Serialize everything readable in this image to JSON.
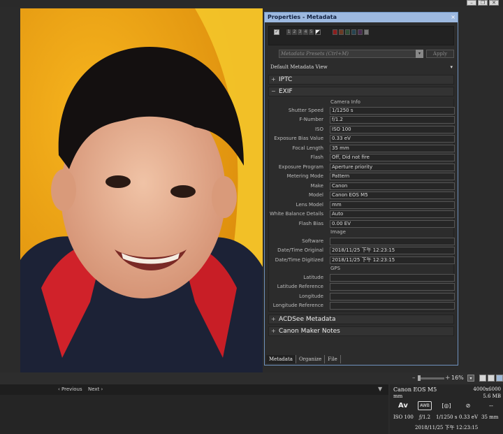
{
  "window": {
    "minimize": "–",
    "restore": "❐",
    "close": "✕"
  },
  "panel": {
    "title": "Properties - Metadata",
    "close_glyph": "×",
    "rating_numbers": [
      "1",
      "2",
      "3",
      "4",
      "5"
    ],
    "color_labels": [
      "#8b1e1e",
      "#6b3a24",
      "#2e4d35",
      "#264350",
      "#4a2d52",
      "#777777"
    ],
    "preset_placeholder": "Metadata Presets (Ctrl+M)",
    "apply_label": "Apply",
    "view_label": "Default Metadata View",
    "sections": {
      "iptc": "IPTC",
      "exif": "EXIF",
      "acdsee": "ACDSee Metadata",
      "maker": "Canon Maker Notes"
    },
    "subsections": {
      "camera": "Camera Info",
      "image": "Image",
      "gps": "GPS"
    },
    "fields": {
      "shutter": {
        "label": "Shutter Speed",
        "value": "1/1250 s"
      },
      "fnumber": {
        "label": "F-Number",
        "value": "f/1.2"
      },
      "iso": {
        "label": "ISO",
        "value": "ISO 100"
      },
      "bias": {
        "label": "Exposure Bias Value",
        "value": "0.33 eV"
      },
      "focal": {
        "label": "Focal Length",
        "value": "35 mm"
      },
      "flash": {
        "label": "Flash",
        "value": "Off, Did not fire"
      },
      "program": {
        "label": "Exposure Program",
        "value": "Aperture priority"
      },
      "metering": {
        "label": "Metering Mode",
        "value": "Pattern"
      },
      "make": {
        "label": "Make",
        "value": "Canon"
      },
      "model": {
        "label": "Model",
        "value": "Canon EOS M5"
      },
      "lens": {
        "label": "Lens Model",
        "value": "mm"
      },
      "wb": {
        "label": "White Balance Details",
        "value": "Auto"
      },
      "flashbias": {
        "label": "Flash Bias",
        "value": "0.00 EV"
      },
      "software": {
        "label": "Software",
        "value": ""
      },
      "dt_orig": {
        "label": "Date/Time Original",
        "value": "2018/11/25 下午 12:23:15"
      },
      "dt_dig": {
        "label": "Date/Time Digitized",
        "value": "2018/11/25 下午 12:23:15"
      },
      "lat": {
        "label": "Latitude",
        "value": ""
      },
      "latref": {
        "label": "Latitude Reference",
        "value": ""
      },
      "lon": {
        "label": "Longitude",
        "value": ""
      },
      "lonref": {
        "label": "Longitude Reference",
        "value": ""
      }
    },
    "tabs": {
      "metadata": "Metadata",
      "organize": "Organize",
      "file": "File"
    }
  },
  "zoom": {
    "minus": "–",
    "plus": "+",
    "percent": "16%"
  },
  "nav": {
    "previous": "‹ Previous",
    "next": "Next ›"
  },
  "info": {
    "camera": "Canon EOS M5",
    "dimensions": "4000x6000",
    "lens_unit": "mm",
    "file_size": "5.6 MB",
    "mode": "Av",
    "wb": "AWB",
    "iso": "ISO 100",
    "aperture": "ƒ/1.2",
    "shutter": "1/1250 s",
    "bias": "0.33 eV",
    "focal": "35 mm",
    "datetime": "2018/11/25 下午 12:23:15",
    "placeholder": "--"
  }
}
